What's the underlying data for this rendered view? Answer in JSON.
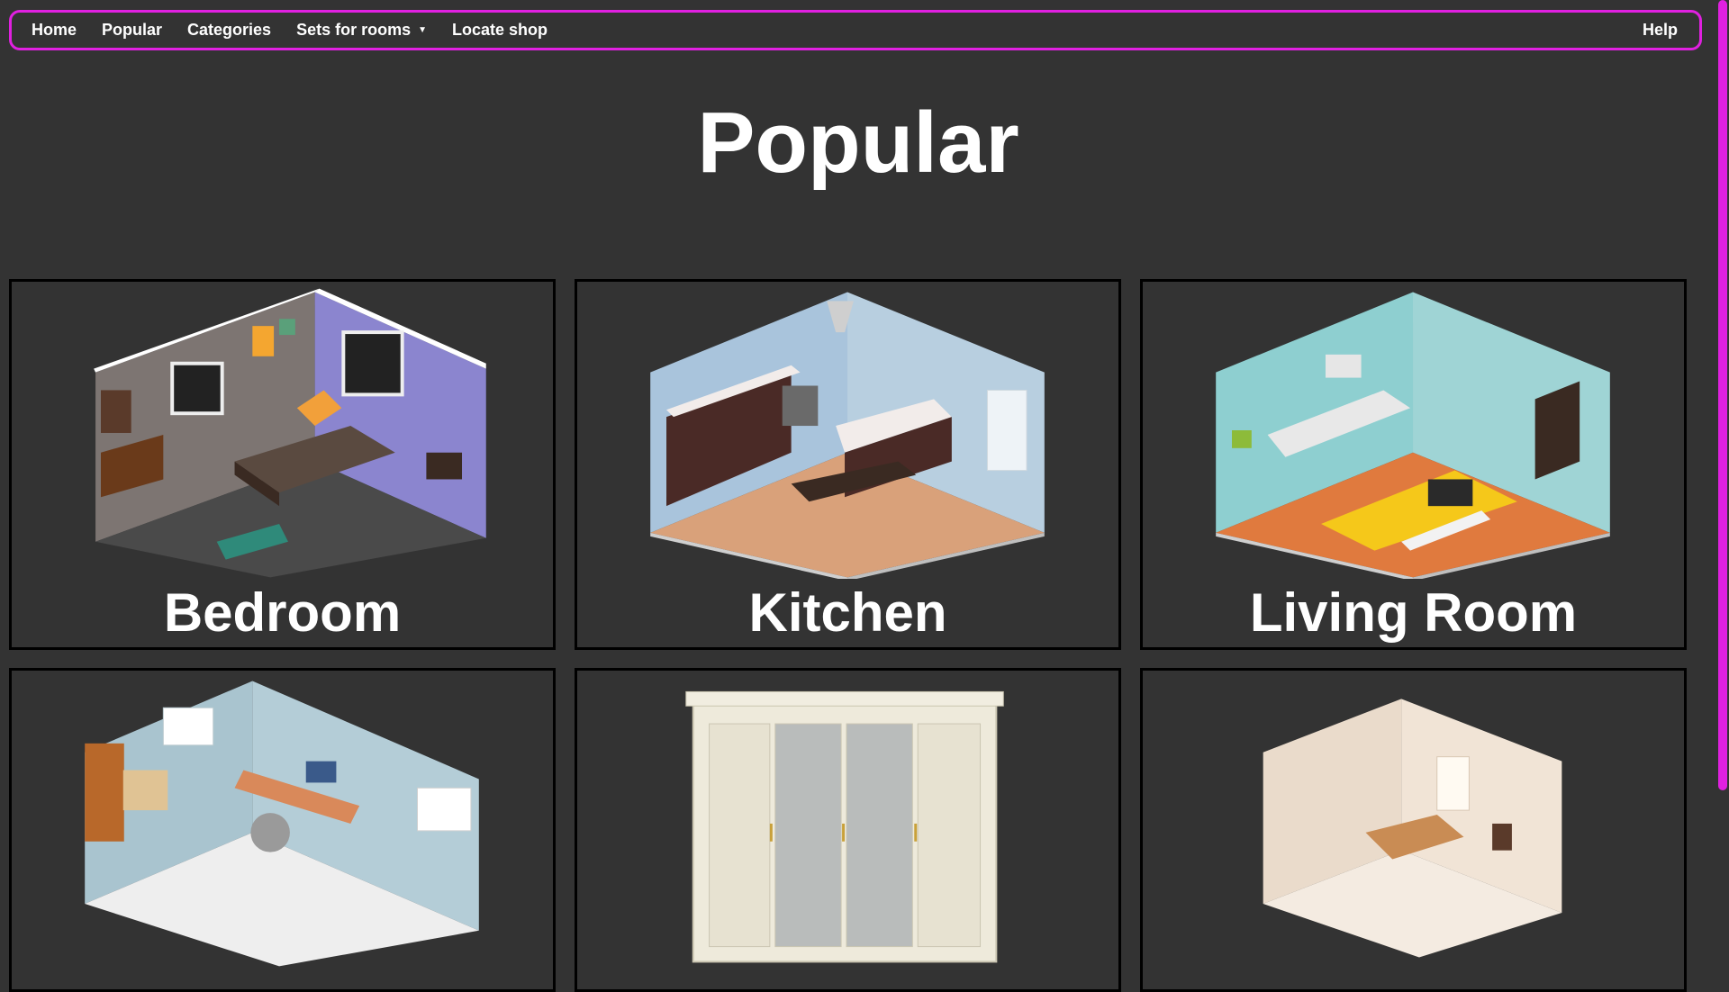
{
  "nav": {
    "items": [
      {
        "label": "Home"
      },
      {
        "label": "Popular"
      },
      {
        "label": "Categories"
      },
      {
        "label": "Sets for rooms",
        "has_dropdown": true
      },
      {
        "label": "Locate shop"
      }
    ],
    "help_label": "Help",
    "border_color": "#e020e0"
  },
  "page": {
    "title": "Popular",
    "background": "#333333"
  },
  "cards": [
    {
      "label": "Bedroom",
      "image": "bedroom-isometric"
    },
    {
      "label": "Kitchen",
      "image": "kitchen-isometric"
    },
    {
      "label": "Living Room",
      "image": "living-room-isometric"
    },
    {
      "label": "",
      "image": "office-isometric"
    },
    {
      "label": "",
      "image": "wardrobe"
    },
    {
      "label": "",
      "image": "dining-room-isometric"
    }
  ]
}
